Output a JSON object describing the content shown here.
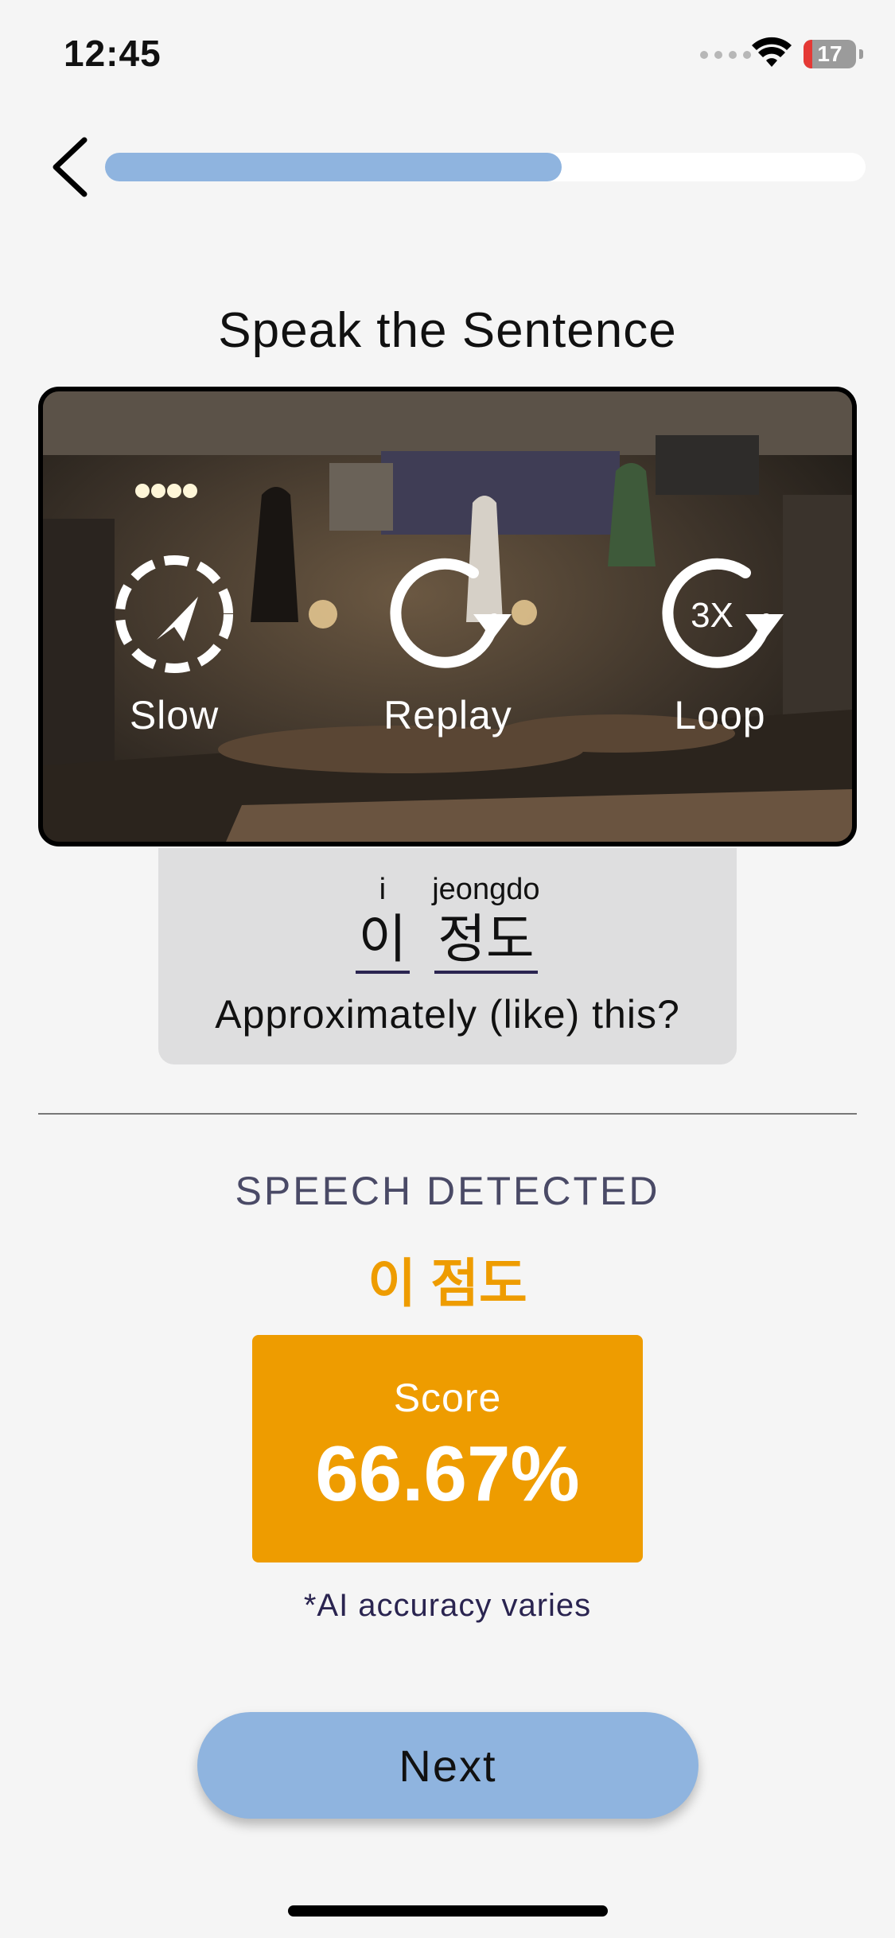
{
  "status_bar": {
    "time": "12:45",
    "battery": "17",
    "icons": [
      "signal-dots-icon",
      "wifi-icon",
      "battery-icon"
    ]
  },
  "header": {
    "back_icon": "chevron-left-icon",
    "progress": 0.6
  },
  "title": "Speak the Sentence",
  "video": {
    "controls": [
      {
        "label": "Slow",
        "icon": "slow-playback-icon"
      },
      {
        "label": "Replay",
        "icon": "replay-icon"
      },
      {
        "label": "Loop",
        "icon": "loop-3x-icon",
        "badge": "3X"
      }
    ]
  },
  "phrase": {
    "words": [
      {
        "romanization": "i",
        "hangul": "이"
      },
      {
        "romanization": "jeongdo",
        "hangul": "정도"
      }
    ],
    "translation": "Approximately (like) this?"
  },
  "result": {
    "detected_label": "SPEECH DETECTED",
    "detected_text": "이 점도",
    "score_label": "Score",
    "score_value": "66.67%",
    "disclaimer": "*AI accuracy varies"
  },
  "next_label": "Next",
  "colors": {
    "accent_blue": "#8fb4df",
    "score_orange": "#ee9c00",
    "background": "#f5f5f5"
  }
}
